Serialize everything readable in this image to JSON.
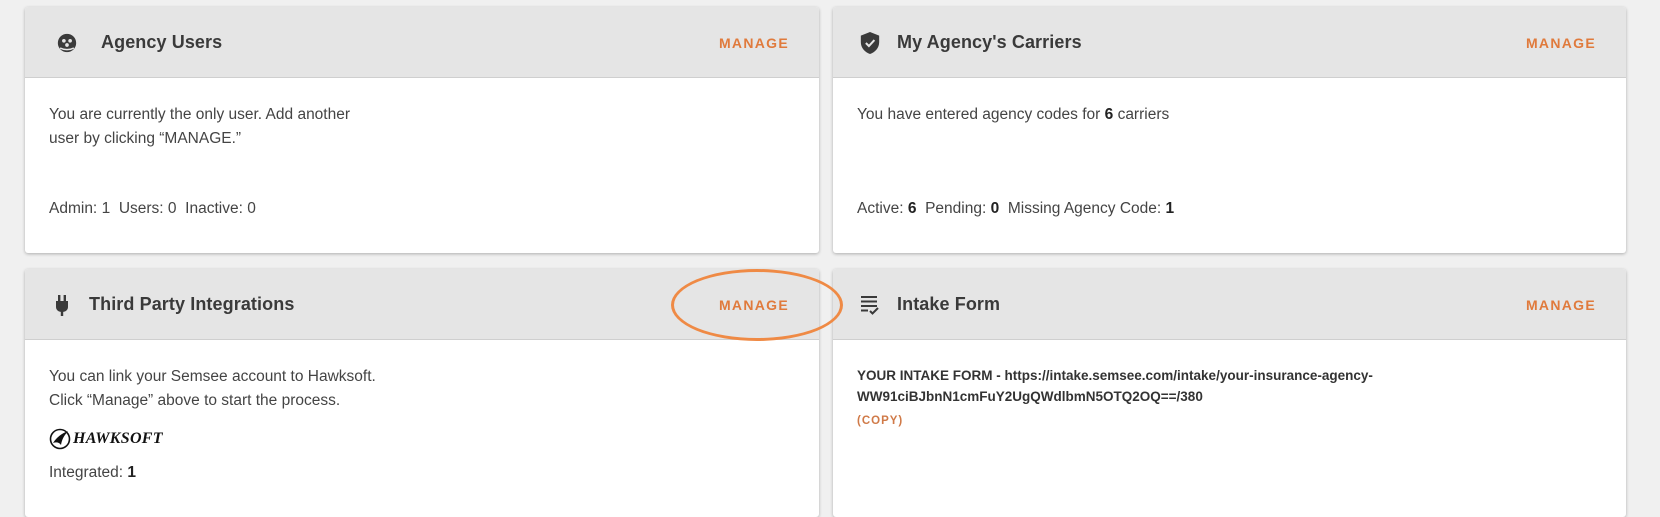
{
  "agency_users": {
    "title": "Agency Users",
    "manage_label": "MANAGE",
    "body_line1": "You are currently the only user. Add another",
    "body_line2": "user by clicking “MANAGE.”",
    "stats": {
      "admin_label": "Admin:",
      "admin_value": "1",
      "users_label": "Users:",
      "users_value": "0",
      "inactive_label": "Inactive:",
      "inactive_value": "0"
    }
  },
  "carriers": {
    "title": "My Agency's Carriers",
    "manage_label": "MANAGE",
    "body_prefix": "You have entered agency codes for",
    "carrier_count": "6",
    "body_suffix": "carriers",
    "stats": {
      "active_label": "Active:",
      "active_value": "6",
      "pending_label": "Pending:",
      "pending_value": "0",
      "missing_label": "Missing Agency Code:",
      "missing_value": "1"
    }
  },
  "integrations": {
    "title": "Third Party Integrations",
    "manage_label": "MANAGE",
    "body_line1": "You can link your Semsee account to Hawksoft.",
    "body_line2": "Click “Manage” above to start the process.",
    "logo_text": "HAWKSOFT",
    "integrated_label": "Integrated:",
    "integrated_value": "1"
  },
  "intake": {
    "title": "Intake Form",
    "manage_label": "MANAGE",
    "form_line1": "YOUR INTAKE FORM - https://intake.semsee.com/intake/your-insurance-agency-",
    "form_line2": "WW91ciBJbnN1cmFuY2UgQWdlbmN5OTQ2OQ==/380",
    "copy_label": "(COPY)"
  },
  "colors": {
    "accent": "#e07a3c",
    "highlight": "#ef8a45",
    "header_bg": "#e5e5e5"
  }
}
